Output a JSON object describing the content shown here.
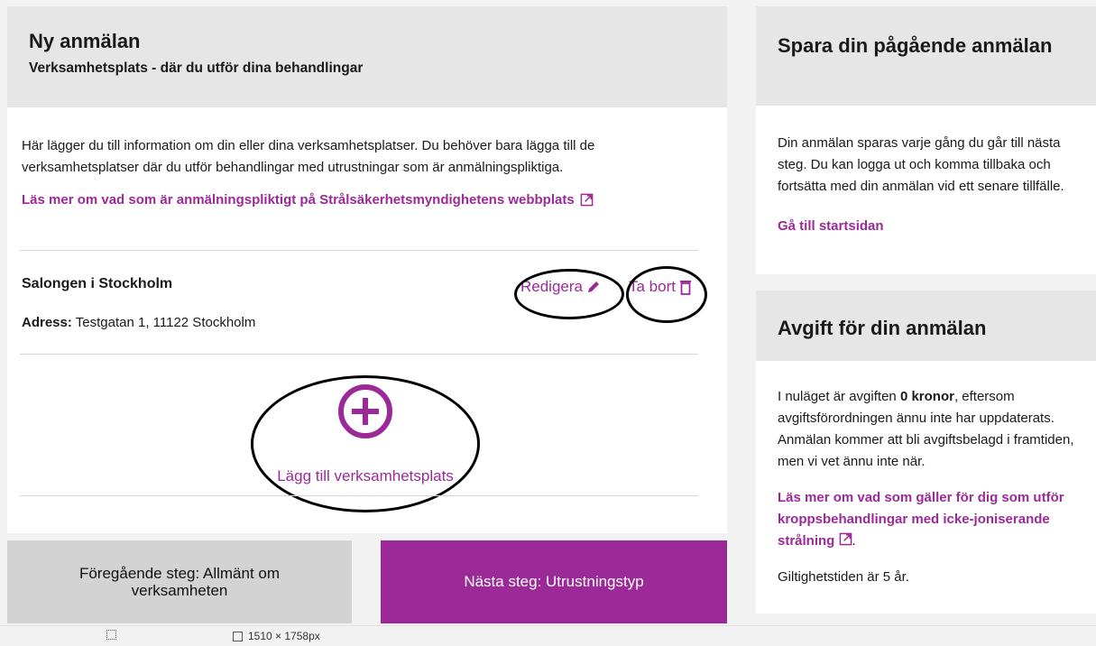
{
  "form": {
    "title": "Ny anmälan",
    "subtitle": "Verksamhetsplats - där du utför dina behandlingar",
    "intro": "Här lägger du till information om din eller dina verksamhetsplatser. Du behöver bara lägga till de verksamhetsplatser där du utför behandlingar med utrustningar som är anmälningspliktiga.",
    "info_link": "Läs mer om vad som är anmälningspliktigt på Strålsäkerhetsmyndighetens webbplats",
    "site": {
      "name": "Salongen i Stockholm",
      "address_label": "Adress:",
      "address_value": "Testgatan 1, 11122 Stockholm",
      "edit_label": "Redigera",
      "delete_label": "Ta bort"
    },
    "add_site_label": "Lägg till verksamhetsplats"
  },
  "navigation": {
    "prev_label": "Föregående steg: Allmänt om verksamheten",
    "next_label": "Nästa steg: Utrustningstyp"
  },
  "save_card": {
    "title": "Spara din pågående anmälan",
    "body": "Din anmälan sparas varje gång du går till nästa steg. Du kan logga ut och komma tillbaka och fortsätta med din anmälan vid ett senare tillfälle.",
    "link": "Gå till startsidan"
  },
  "fee_card": {
    "title": "Avgift för din anmälan",
    "body_pre": "I nuläget är avgiften ",
    "body_amount": "0 kronor",
    "body_post": ", eftersom avgiftsförordningen ännu inte har uppdaterats. Anmälan kommer att bli avgiftsbelagd i framtiden, men vi vet ännu inte när.",
    "link": "Läs mer om vad som gäller för dig som utför kroppsbehandlingar med icke-joniserande strålning",
    "link_suffix": ".",
    "validity": "Giltighetstiden är 5 år."
  },
  "statusbar": {
    "dimensions": "1510 × 1758px"
  },
  "colors": {
    "accent": "#9b2a98",
    "header_bg": "#e6e6e6",
    "secondary_button": "#d3d3d3"
  },
  "icons": [
    "external-link-icon",
    "pencil-icon",
    "trash-icon",
    "plus-circle-icon",
    "selection-icon",
    "dimensions-icon"
  ]
}
